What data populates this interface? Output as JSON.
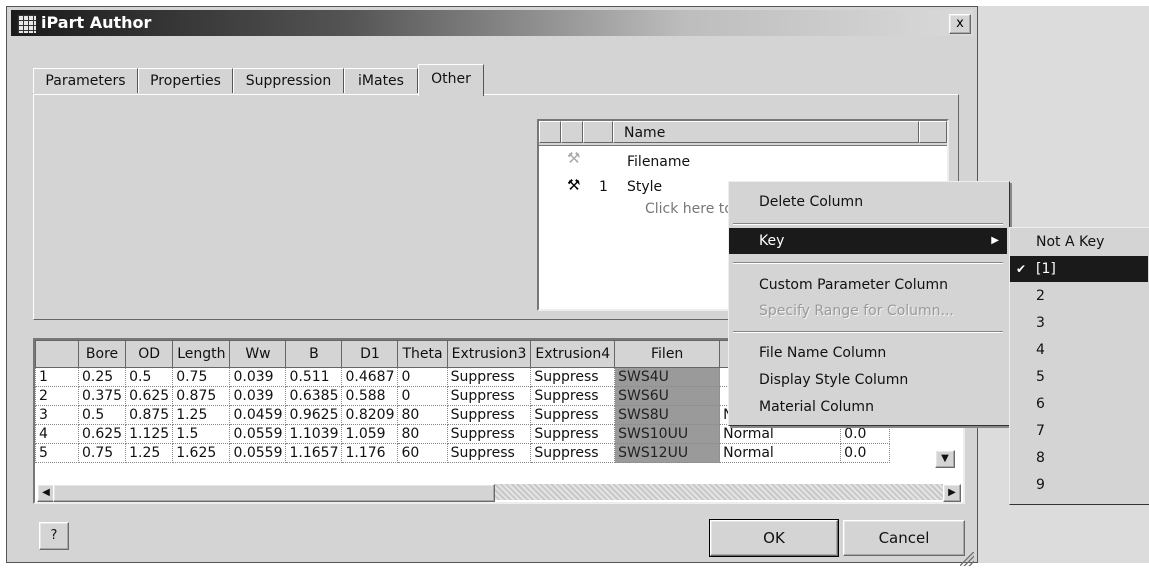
{
  "window": {
    "title": "iPart Author",
    "close_label": "x"
  },
  "tabs": [
    {
      "label": "Parameters"
    },
    {
      "label": "Properties"
    },
    {
      "label": "Suppression"
    },
    {
      "label": "iMates"
    },
    {
      "label": "Other",
      "active": true
    }
  ],
  "name_list": {
    "header": "Name",
    "rows": [
      {
        "key_icon": "key-icon-inactive",
        "key_number": "",
        "name": "Filename"
      },
      {
        "key_icon": "key-icon",
        "key_number": "1",
        "name": "Style"
      }
    ],
    "add_row_hint": "Click here to"
  },
  "table": {
    "columns": [
      "",
      "Bore",
      "OD",
      "Length",
      "Ww",
      "B",
      "D1",
      "Theta",
      "Extrusion3",
      "Extrusion4",
      "Filen",
      "",
      ""
    ],
    "rows": [
      [
        "1",
        "0.25",
        "0.5",
        "0.75",
        "0.039",
        "0.511",
        "0.4687",
        "0",
        "Suppress",
        "Suppress",
        "SWS4U",
        "",
        ""
      ],
      [
        "2",
        "0.375",
        "0.625",
        "0.875",
        "0.039",
        "0.6385",
        "0.588",
        "0",
        "Suppress",
        "Suppress",
        "SWS6U",
        "",
        ""
      ],
      [
        "3",
        "0.5",
        "0.875",
        "1.25",
        "0.0459",
        "0.9625",
        "0.8209",
        "80",
        "Suppress",
        "Suppress",
        "SWS8U",
        "Normal",
        ""
      ],
      [
        "4",
        "0.625",
        "1.125",
        "1.5",
        "0.0559",
        "1.1039",
        "1.059",
        "80",
        "Suppress",
        "Suppress",
        "SWS10UU",
        "Normal",
        "0.0"
      ],
      [
        "5",
        "0.75",
        "1.25",
        "1.625",
        "0.0559",
        "1.1657",
        "1.176",
        "60",
        "Suppress",
        "Suppress",
        "SWS12UU",
        "Normal",
        "0.0"
      ]
    ]
  },
  "buttons": {
    "ok": "OK",
    "cancel": "Cancel",
    "help": "?"
  },
  "context_menu": {
    "items": [
      {
        "label": "Delete Column"
      },
      {
        "label": "Key",
        "submenu": true,
        "selected": true
      },
      {
        "label": "Custom Parameter Column"
      },
      {
        "label": "Specify Range for Column...",
        "disabled": true
      },
      {
        "label": "File Name Column"
      },
      {
        "label": "Display Style Column"
      },
      {
        "label": "Material Column"
      }
    ]
  },
  "key_submenu": {
    "items": [
      "Not A Key",
      "[1]",
      "2",
      "3",
      "4",
      "5",
      "6",
      "7",
      "8",
      "9"
    ],
    "checked": "[1]"
  }
}
